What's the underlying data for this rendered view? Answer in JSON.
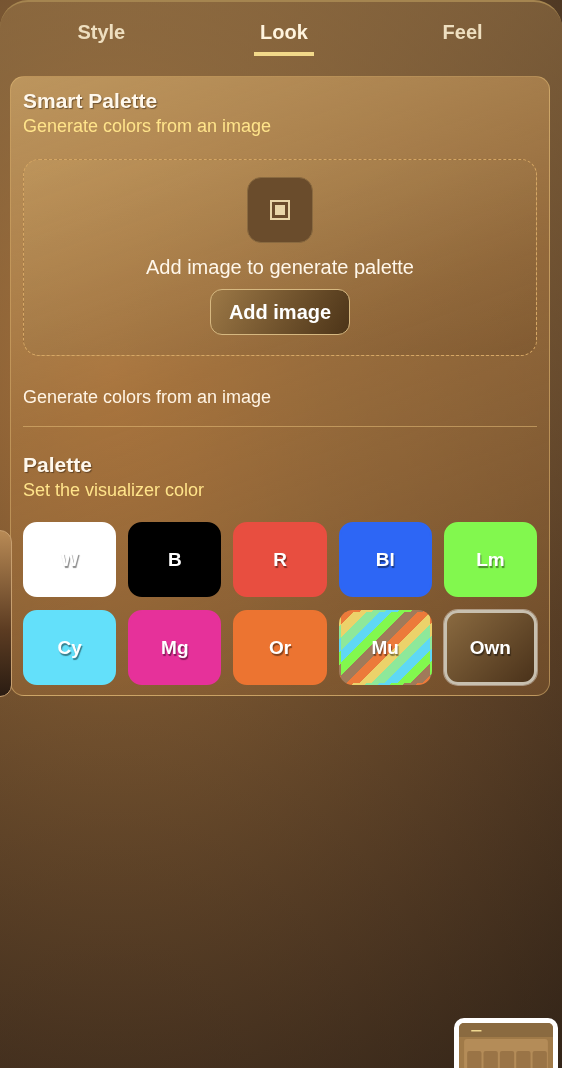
{
  "tabs": [
    {
      "label": "Style",
      "selected": false
    },
    {
      "label": "Look",
      "selected": true
    },
    {
      "label": "Feel",
      "selected": false
    }
  ],
  "smart_palette": {
    "title": "Smart Palette",
    "subtitle": "Generate colors from an image",
    "drop_text": "Add image to generate palette",
    "button": "Add image",
    "note": "Generate colors from an image"
  },
  "palette": {
    "title": "Palette",
    "subtitle": "Set the visualizer color",
    "swatches": [
      {
        "label": "W",
        "kind": "solid",
        "color": "#ffffff",
        "selected": false
      },
      {
        "label": "B",
        "kind": "solid",
        "color": "#000000",
        "selected": false
      },
      {
        "label": "R",
        "kind": "solid",
        "color": "#e84e40",
        "selected": false
      },
      {
        "label": "Bl",
        "kind": "solid",
        "color": "#2d66f5",
        "selected": false
      },
      {
        "label": "Lm",
        "kind": "solid",
        "color": "#82f84e",
        "selected": false
      },
      {
        "label": "Cy",
        "kind": "solid",
        "color": "#63e0fa",
        "selected": false
      },
      {
        "label": "Mg",
        "kind": "solid",
        "color": "#e6319a",
        "selected": false
      },
      {
        "label": "Or",
        "kind": "solid",
        "color": "#ec7431",
        "selected": false
      },
      {
        "label": "Mu",
        "kind": "multi",
        "selected": false
      },
      {
        "label": "Own",
        "kind": "custom",
        "selected": true
      }
    ]
  }
}
